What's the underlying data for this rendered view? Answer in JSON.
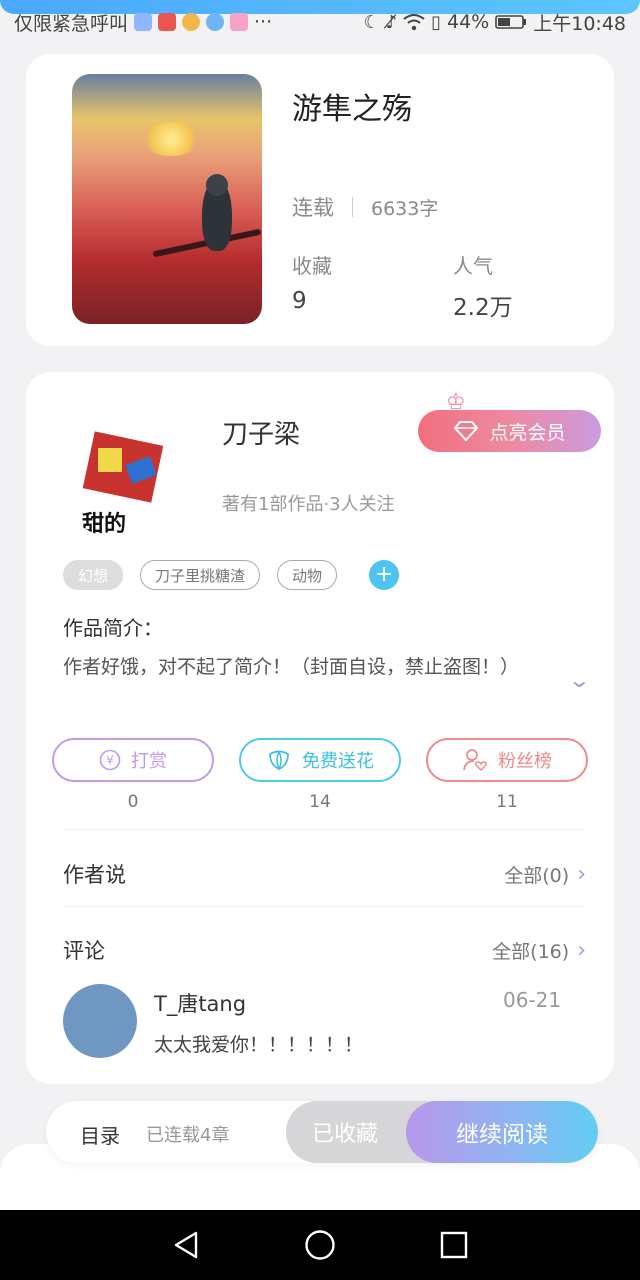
{
  "status_bar": {
    "carrier": "仅限紧急呼叫",
    "more": "···",
    "battery": "44%",
    "time": "上午10:48"
  },
  "book": {
    "title": "游隼之殇",
    "status": "连载",
    "word_count": "6633字",
    "favorites_label": "收藏",
    "favorites_value": "9",
    "popularity_label": "人气",
    "popularity_value": "2.2万"
  },
  "author": {
    "name": "刀子梁",
    "meta": "著有1部作品·3人关注",
    "vip_label": "点亮会员",
    "avatar_text": "甜的"
  },
  "tags": [
    "幻想",
    "刀子里挑糖渣",
    "动物"
  ],
  "intro": {
    "label": "作品简介：",
    "text": "作者好饿，对不起了简介！（封面自设，禁止盗图！）"
  },
  "actions": [
    {
      "label": "打赏",
      "count": "0",
      "color": "#c49ae4"
    },
    {
      "label": "免费送花",
      "count": "14",
      "color": "#4ccbe6"
    },
    {
      "label": "粉丝榜",
      "count": "11",
      "color": "#ee8a8a"
    }
  ],
  "author_says": {
    "title": "作者说",
    "link": "全部(0)"
  },
  "comments": {
    "title": "评论",
    "link": "全部(16)",
    "items": [
      {
        "user": "T_唐tang",
        "date": "06-21",
        "text": "太太我爱你！！！！！！"
      }
    ]
  },
  "bottom_bar": {
    "toc": "目录",
    "toc_sub": "已连载4章",
    "collected": "已收藏",
    "continue": "继续阅读"
  },
  "icons": {
    "accent_purple": "#b48fe6",
    "accent_blue": "#4dc4f2"
  }
}
